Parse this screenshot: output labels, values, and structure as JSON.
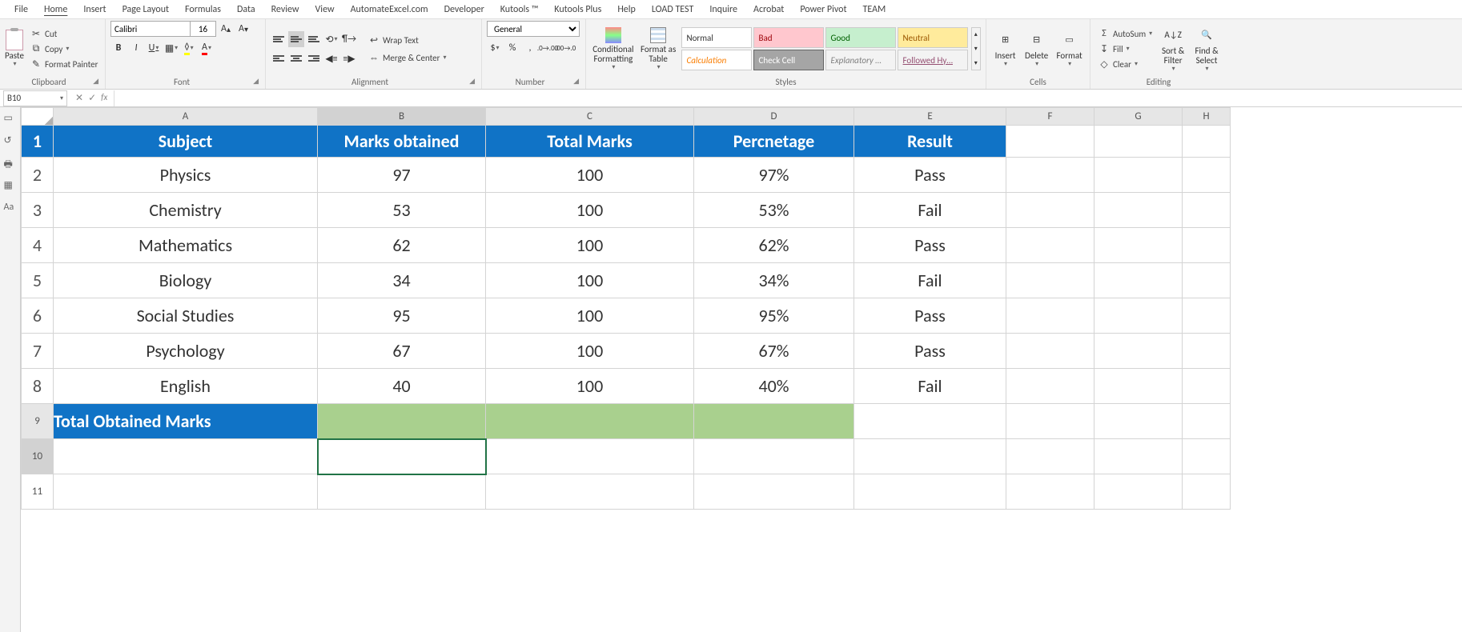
{
  "ribbon": {
    "tabs": [
      "File",
      "Home",
      "Insert",
      "Page Layout",
      "Formulas",
      "Data",
      "Review",
      "View",
      "AutomateExcel.com",
      "Developer",
      "Kutools ™",
      "Kutools Plus",
      "Help",
      "LOAD TEST",
      "Inquire",
      "Acrobat",
      "Power Pivot",
      "TEAM"
    ],
    "active_tab": "Home",
    "clipboard": {
      "paste": "Paste",
      "cut": "Cut",
      "copy": "Copy",
      "format_painter": "Format Painter",
      "label": "Clipboard"
    },
    "font": {
      "name": "Calibri",
      "size": "16",
      "label": "Font"
    },
    "alignment": {
      "wrap": "Wrap Text",
      "merge": "Merge & Center",
      "label": "Alignment"
    },
    "number": {
      "format": "General",
      "label": "Number"
    },
    "styles": {
      "cond": "Conditional Formatting",
      "table": "Format as Table",
      "items": [
        "Normal",
        "Bad",
        "Good",
        "Neutral",
        "Calculation",
        "Check Cell",
        "Explanatory …",
        "Followed Hy…"
      ],
      "label": "Styles"
    },
    "cells": {
      "insert": "Insert",
      "delete": "Delete",
      "format": "Format",
      "label": "Cells"
    },
    "editing": {
      "autosum": "AutoSum",
      "fill": "Fill",
      "clear": "Clear",
      "sort": "Sort & Filter",
      "find": "Find & Select",
      "label": "Editing"
    }
  },
  "name_box": "B10",
  "columns": [
    "A",
    "B",
    "C",
    "D",
    "E",
    "F",
    "G",
    "H"
  ],
  "sheet": {
    "header": [
      "Subject",
      "Marks obtained",
      "Total Marks",
      "Percnetage",
      "Result"
    ],
    "rows": [
      [
        "Physics",
        "97",
        "100",
        "97%",
        "Pass"
      ],
      [
        "Chemistry",
        "53",
        "100",
        "53%",
        "Fail"
      ],
      [
        "Mathematics",
        "62",
        "100",
        "62%",
        "Pass"
      ],
      [
        "Biology",
        "34",
        "100",
        "34%",
        "Fail"
      ],
      [
        "Social Studies",
        "95",
        "100",
        "95%",
        "Pass"
      ],
      [
        "Psychology",
        "67",
        "100",
        "67%",
        "Pass"
      ],
      [
        "English",
        "40",
        "100",
        "40%",
        "Fail"
      ]
    ],
    "total_label": "Total Obtained Marks"
  }
}
